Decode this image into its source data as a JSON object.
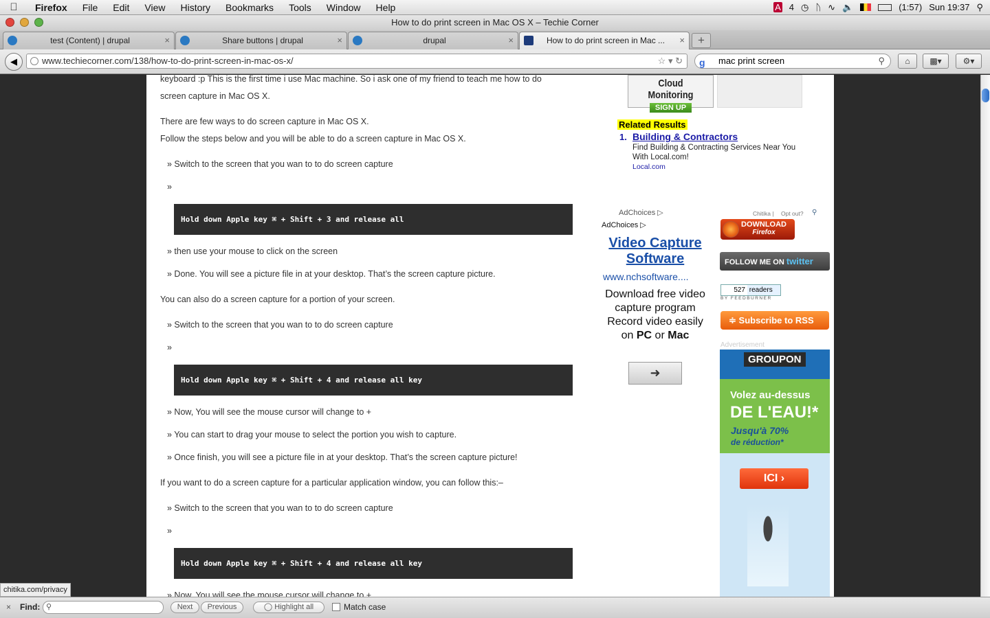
{
  "menubar": {
    "app": "Firefox",
    "items": [
      "File",
      "Edit",
      "View",
      "History",
      "Bookmarks",
      "Tools",
      "Window",
      "Help"
    ],
    "battery": "(1:57)",
    "clock": "Sun 19:37",
    "badge": "4"
  },
  "window": {
    "title": "How to do print screen in Mac OS X – Techie Corner"
  },
  "tabs": [
    {
      "label": "test (Content) | drupal"
    },
    {
      "label": "Share buttons | drupal"
    },
    {
      "label": "drupal"
    },
    {
      "label": "How to do print screen in Mac ..."
    }
  ],
  "nav": {
    "url": "www.techiecorner.com/138/how-to-do-print-screen-in-mac-os-x/",
    "search": "mac print screen"
  },
  "article": {
    "p0": "keyboard :p This is the first time i use Mac machine. So i ask one of my friend to teach me how to do",
    "p1": "screen capture in Mac OS X.",
    "p2": "There are few ways to do screen capture in Mac OS X.",
    "p3": "Follow the steps below and you will be able to do a screen capture in Mac OS X.",
    "s1": "» Switch to the screen that you wan to to do screen capture",
    "s2": "»",
    "c1": "Hold down Apple key ⌘ + Shift + 3 and release all",
    "s3": "» then use your mouse to click on the screen",
    "s4": "» Done. You will see a picture file in at your desktop. That’s the screen capture picture.",
    "p4": "You can also do a screen capture for a portion of your screen.",
    "s5": "» Switch to the screen that you wan to to do screen capture",
    "s6": "»",
    "c2": "Hold down Apple key ⌘ + Shift + 4 and release all key",
    "s7": "» Now, You will see the mouse cursor will change to +",
    "s8": "» You can start to drag your mouse to select the portion you wish to capture.",
    "s9": "» Once finish, you will see a picture file in at your desktop. That’s the screen capture picture!",
    "p5": "If you want to do a screen capture for a particular application window, you can follow this:–",
    "s10": "» Switch to the screen that you wan to to do screen capture",
    "s11": "»",
    "c3": "Hold down Apple key ⌘ + Shift + 4 and release all key",
    "s12": "» Now, You will see the mouse cursor will change to +"
  },
  "sidebar": {
    "cloud1": "Cloud Monitoring",
    "cloud2": "SIGN UP",
    "related": "Related Results",
    "rel_num": "1.",
    "rel_link": "Building & Contractors",
    "rel_desc": "Find Building & Contracting Services Near You With Local.com!",
    "rel_site": "Local.com",
    "adchoices": "AdChoices",
    "chitika": "Chitika |",
    "optout": "Opt out?",
    "ad_choices2": "AdChoices",
    "ad_title": "Video Capture Software",
    "ad_url": "www.nchsoftware....",
    "ad_body": "Download free video capture program Record video easily on ",
    "ad_pc": "PC",
    "ad_or": " or ",
    "ad_mac": "Mac",
    "ff1": "DOWNLOAD",
    "ff2": "Firefox",
    "twitter": "FOLLOW ME ON",
    "twitter_b": "twitter",
    "readers_n": "527",
    "readers": "readers",
    "feedburner": "BY FEEDBURNER",
    "rss": "Subscribe to RSS",
    "advert": "Advertisement",
    "groupon": "GROUPON",
    "g1": "Volez au-dessus",
    "g2": "DE L'EAU!*",
    "g3": "Jusqu'à 70%",
    "g4": "de réduction*",
    "g5": "ICI"
  },
  "status": "chitika.com/privacy",
  "find": {
    "label": "Find:",
    "next": "Next",
    "previous": "Previous",
    "highlight": "Highlight all",
    "match": "Match case"
  }
}
